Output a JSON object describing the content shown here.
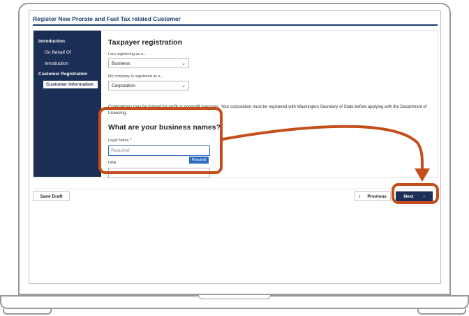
{
  "app": {
    "title": "Register New Prorate and Fuel Tax related Customer"
  },
  "sidebar": {
    "items": [
      {
        "label": "Introduction"
      },
      {
        "label": "On Behalf Of"
      },
      {
        "label": "Introduction"
      },
      {
        "label": "Customer Registration"
      },
      {
        "label": "Customer Information"
      }
    ]
  },
  "form": {
    "title": "Taxpayer registration",
    "registering_as": {
      "label": "I am registering as a...",
      "value": "Business"
    },
    "company_type": {
      "label": "My company is registered as a...",
      "value": "Corporation"
    },
    "note": "Corporations may be formed for profit or nonprofit purposes. Your corporation must be registered with Washington Secretary of State before applying with the Department of Licensing.",
    "names_title": "What are your business names?",
    "legal_name": {
      "label": "Legal Name",
      "required_mark": "*",
      "placeholder": "Required",
      "badge": "Required"
    },
    "dba": {
      "label": "DBA"
    }
  },
  "footer": {
    "save_draft": "Save Draft",
    "previous": "Previous",
    "next": "Next",
    "prev_icon": "‹",
    "next_icon": "›"
  },
  "colors": {
    "accent": "#c44d1a",
    "navy": "#1b2e55",
    "focus": "#2a6cc0"
  }
}
